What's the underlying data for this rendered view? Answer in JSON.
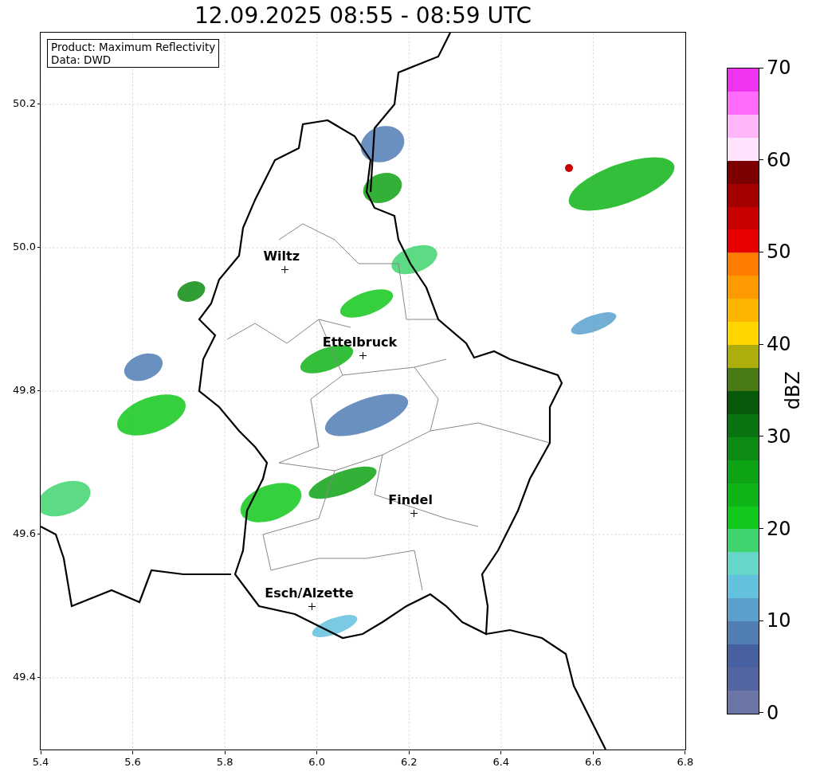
{
  "title": "12.09.2025 08:55 - 08:59 UTC",
  "info_box": {
    "lines": [
      "Product: Maximum Reflectivity",
      "Data: DWD"
    ]
  },
  "map": {
    "cities": [
      {
        "name": "Wiltz"
      },
      {
        "name": "Ettelbruck"
      },
      {
        "name": "Findel"
      },
      {
        "name": "Esch/Alzette"
      }
    ]
  },
  "y_ticks": [
    "50.2",
    "50.0",
    "49.8",
    "49.6",
    "49.4"
  ],
  "x_ticks": [
    "5.4",
    "5.6",
    "5.8",
    "6.0",
    "6.2",
    "6.4",
    "6.6",
    "6.8"
  ],
  "colorbar": {
    "label": "dBZ",
    "ticks": [
      "70",
      "60",
      "50",
      "40",
      "30",
      "20",
      "10",
      "0"
    ],
    "bands": [
      {
        "color": "#ee34ee"
      },
      {
        "color": "#ff6cfc"
      },
      {
        "color": "#ffb6f8"
      },
      {
        "color": "#ffe2fc"
      },
      {
        "color": "#7c0000"
      },
      {
        "color": "#a50000"
      },
      {
        "color": "#c80000"
      },
      {
        "color": "#e80000"
      },
      {
        "color": "#ff7c00"
      },
      {
        "color": "#ff9a00"
      },
      {
        "color": "#ffb400"
      },
      {
        "color": "#ffd600"
      },
      {
        "color": "#adae0c"
      },
      {
        "color": "#4a7a14"
      },
      {
        "color": "#075a0a"
      },
      {
        "color": "#0a7510"
      },
      {
        "color": "#0c8c12"
      },
      {
        "color": "#0ea215"
      },
      {
        "color": "#0fb418"
      },
      {
        "color": "#13c81c"
      },
      {
        "color": "#40d46e"
      },
      {
        "color": "#66d6c8"
      },
      {
        "color": "#64c1de"
      },
      {
        "color": "#5ba0cc"
      },
      {
        "color": "#4f7db4"
      },
      {
        "color": "#4760a2"
      },
      {
        "color": "#5365a0"
      },
      {
        "color": "#6b76a6"
      }
    ]
  }
}
